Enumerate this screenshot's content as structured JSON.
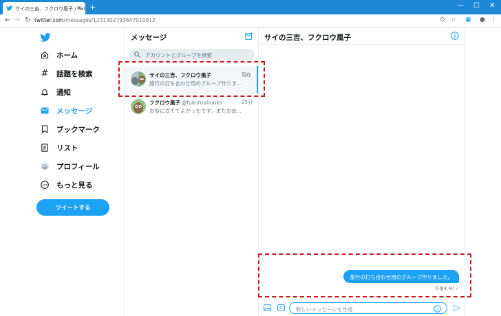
{
  "browser": {
    "tab_title": "サイの三吉、フクロウ風子 / Twitter",
    "url_host": "twitter.com",
    "url_path": "/messages/1231302793647910912"
  },
  "nav": {
    "items": [
      {
        "label": "ホーム",
        "icon": "home-icon"
      },
      {
        "label": "話題を検索",
        "icon": "hashtag-icon"
      },
      {
        "label": "通知",
        "icon": "bell-icon"
      },
      {
        "label": "メッセージ",
        "icon": "mail-icon"
      },
      {
        "label": "ブックマーク",
        "icon": "bookmark-icon"
      },
      {
        "label": "リスト",
        "icon": "list-icon"
      },
      {
        "label": "プロフィール",
        "icon": "avatar-icon"
      },
      {
        "label": "もっと見る",
        "icon": "more-icon"
      }
    ],
    "tweet_button": "ツイートする"
  },
  "messages": {
    "title": "メッセージ",
    "search_placeholder": "アカウントとグループを検索",
    "conversations": [
      {
        "name": "サイの三吉、フクロウ風子",
        "handle": "",
        "time": "現在",
        "preview": "旅行の打ち合わせ用のグループ作りま..."
      },
      {
        "name": "フクロウ風子",
        "handle": "@fukurouhuuko",
        "time": "25分",
        "preview": "お役に立ててよかったです。またお会..."
      }
    ]
  },
  "chat": {
    "title": "サイの三吉、フクロウ風子",
    "message": "旅行の打ち合わせ用のグループ作りました。",
    "timestamp": "午後4:40 ✓",
    "input_placeholder": "新しいメッセージを作成"
  },
  "colors": {
    "accent": "#1da1f2",
    "highlight": "#c8181e"
  }
}
